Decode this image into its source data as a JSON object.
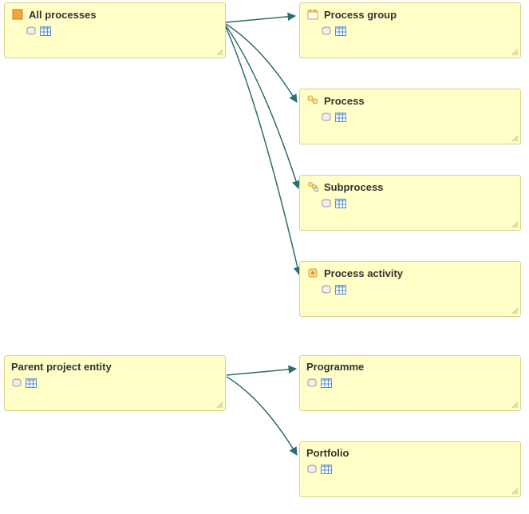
{
  "nodes": {
    "all_processes": {
      "label": "All processes",
      "icon": "square-orange"
    },
    "process_group": {
      "label": "Process group",
      "icon": "calendar"
    },
    "process": {
      "label": "Process",
      "icon": "circles"
    },
    "subprocess": {
      "label": "Subprocess",
      "icon": "magnify-circles"
    },
    "process_activity": {
      "label": "Process activity",
      "icon": "activity"
    },
    "parent_project": {
      "label": "Parent project entity",
      "icon": "none"
    },
    "programme": {
      "label": "Programme",
      "icon": "none"
    },
    "portfolio": {
      "label": "Portfolio",
      "icon": "none"
    }
  },
  "colors": {
    "node_bg": "#ffffc7",
    "node_border": "#d4d489",
    "connector": "#2a6e6e",
    "icon_orange": "#e58a2e",
    "icon_blue": "#6fa8dc"
  }
}
